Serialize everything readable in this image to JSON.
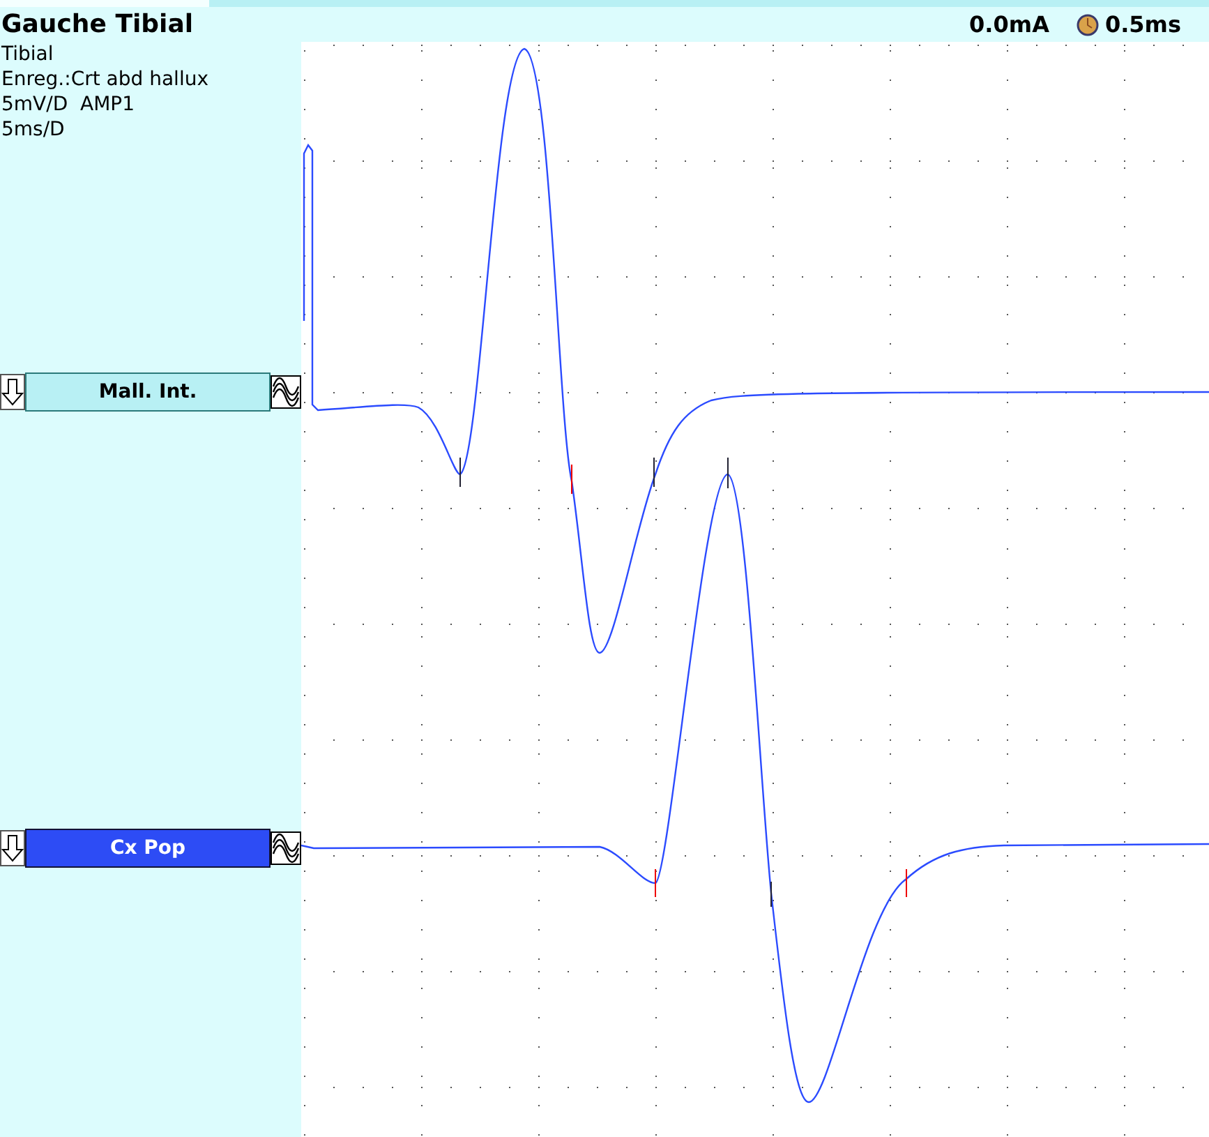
{
  "header": {
    "title": "Gauche Tibial",
    "intensity": "0.0mA",
    "duration": "0.5ms"
  },
  "info_lines": [
    "Tibial",
    "Enreg.:Crt abd hallux",
    "5mV/D  AMP1",
    "5ms/D"
  ],
  "channels": [
    {
      "label": "Mall. Int.",
      "selected": false
    },
    {
      "label": "Cx Pop",
      "selected": true
    }
  ]
}
